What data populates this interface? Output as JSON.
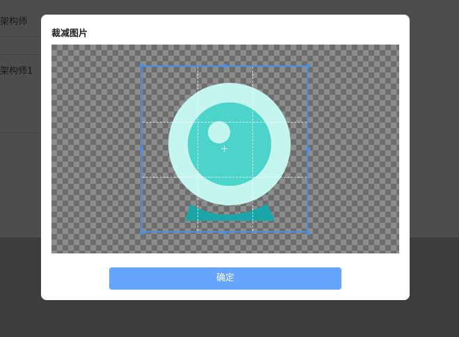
{
  "background": {
    "rows": [
      "架构师",
      "架构师1"
    ]
  },
  "modal": {
    "title": "裁减图片",
    "confirm_label": "确定",
    "image_icon": "webcam-icon"
  },
  "colors": {
    "crop_border": "#4a90e2",
    "confirm_button": "#65a5fb",
    "icon_outer": "#c4f5ef",
    "icon_inner": "#4cd4ca",
    "icon_base": "#1aa6a8"
  }
}
